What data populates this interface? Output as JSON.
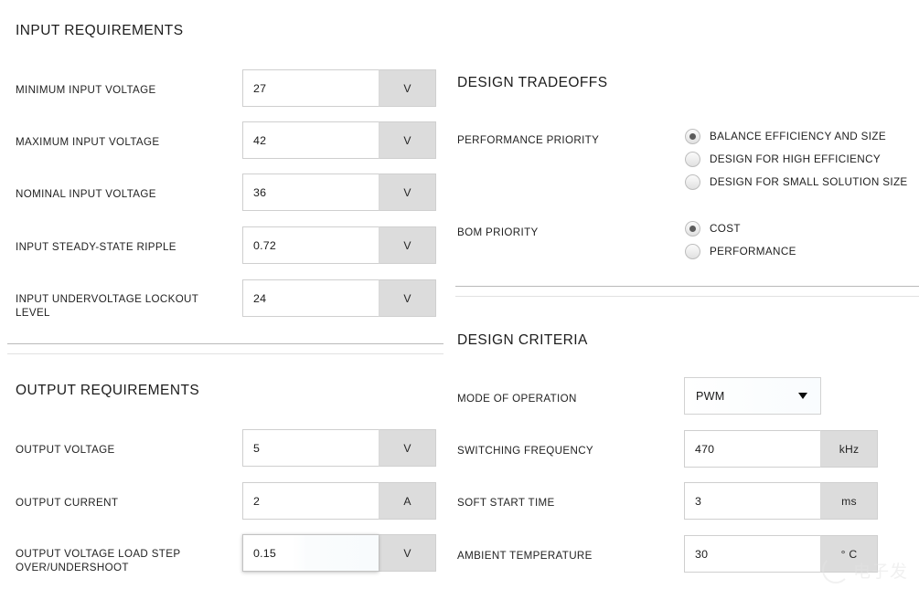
{
  "left_column": {
    "input_section": {
      "title": "INPUT REQUIREMENTS",
      "fields": [
        {
          "label": "MINIMUM INPUT VOLTAGE",
          "value": "27",
          "unit": "V",
          "focused": false
        },
        {
          "label": "MAXIMUM INPUT VOLTAGE",
          "value": "42",
          "unit": "V",
          "focused": false
        },
        {
          "label": "NOMINAL INPUT VOLTAGE",
          "value": "36",
          "unit": "V",
          "focused": false
        },
        {
          "label": "INPUT STEADY-STATE RIPPLE",
          "value": "0.72",
          "unit": "V",
          "focused": false
        },
        {
          "label": "INPUT UNDERVOLTAGE LOCKOUT\nLEVEL",
          "value": "24",
          "unit": "V",
          "focused": false
        }
      ]
    },
    "output_section": {
      "title": "OUTPUT REQUIREMENTS",
      "fields": [
        {
          "label": "OUTPUT VOLTAGE",
          "value": "5",
          "unit": "V",
          "focused": false
        },
        {
          "label": "OUTPUT CURRENT",
          "value": "2",
          "unit": "A",
          "focused": false
        },
        {
          "label": "OUTPUT VOLTAGE LOAD STEP\nOVER/UNDERSHOOT",
          "value": "0.15",
          "unit": "V",
          "focused": true
        }
      ]
    }
  },
  "right_column": {
    "tradeoffs_section": {
      "title": "DESIGN TRADEOFFS",
      "groups": [
        {
          "label": "PERFORMANCE PRIORITY",
          "options": [
            {
              "label": "BALANCE EFFICIENCY AND SIZE",
              "selected": true
            },
            {
              "label": "DESIGN FOR HIGH EFFICIENCY",
              "selected": false
            },
            {
              "label": "DESIGN FOR SMALL SOLUTION SIZE",
              "selected": false
            }
          ]
        },
        {
          "label": "BOM PRIORITY",
          "options": [
            {
              "label": "COST",
              "selected": true
            },
            {
              "label": "PERFORMANCE",
              "selected": false
            }
          ]
        }
      ]
    },
    "criteria_section": {
      "title": "DESIGN CRITERIA",
      "mode_field": {
        "label": "MODE OF OPERATION",
        "value": "PWM",
        "icon": "chevron-down-icon"
      },
      "fields": [
        {
          "label": "SWITCHING FREQUENCY",
          "value": "470",
          "unit": "kHz"
        },
        {
          "label": "SOFT START TIME",
          "value": "3",
          "unit": "ms"
        },
        {
          "label": "AMBIENT TEMPERATURE",
          "value": "30",
          "unit": "° C"
        }
      ]
    }
  },
  "watermark": {
    "text": "电子发"
  },
  "colors": {
    "unit_background": "#dcdcdc",
    "input_border": "#cfcfcf",
    "divider_top": "#b9b9b9",
    "divider_bottom": "#e2e2e2",
    "radio_dot": "#5c5c5c",
    "text": "#1a1a1a"
  }
}
